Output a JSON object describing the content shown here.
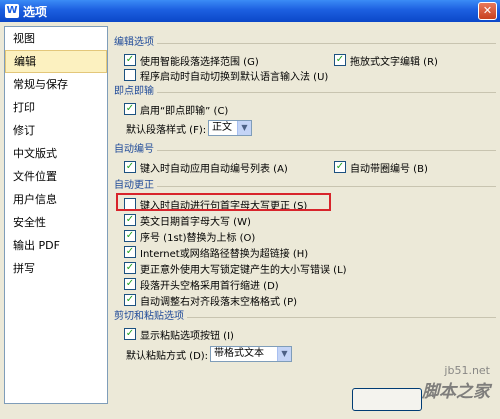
{
  "window": {
    "title": "选项",
    "app_icon": "wps-icon"
  },
  "sidebar": {
    "items": [
      {
        "label": "视图"
      },
      {
        "label": "编辑",
        "selected": true
      },
      {
        "label": "常规与保存"
      },
      {
        "label": "打印"
      },
      {
        "label": "修订"
      },
      {
        "label": "中文版式"
      },
      {
        "label": "文件位置"
      },
      {
        "label": "用户信息"
      },
      {
        "label": "安全性"
      },
      {
        "label": "输出 PDF"
      },
      {
        "label": "拼写"
      }
    ]
  },
  "editing_options": {
    "title": "编辑选项",
    "smart_select": {
      "label": "使用智能段落选择范围 (G)",
      "checked": true
    },
    "drag_drop": {
      "label": "拖放式文字编辑 (R)",
      "checked": true
    },
    "auto_ime": {
      "label": "程序启动时自动切换到默认语言输入法 (U)",
      "checked": false
    }
  },
  "click_type": {
    "title": "即点即输",
    "enable": {
      "label": "启用“即点即输” (C)",
      "checked": true
    },
    "default_style_label": "默认段落样式 (F):",
    "default_style_value": "正文"
  },
  "auto_numbering": {
    "title": "自动编号",
    "auto_list": {
      "label": "键入时自动应用自动编号列表 (A)",
      "checked": true
    },
    "auto_circled": {
      "label": "自动带圈编号 (B)",
      "checked": true
    }
  },
  "auto_correct": {
    "title": "自动更正",
    "capitalize_first": {
      "label": "键入时自动进行句首字母大写更正 (S)",
      "checked": false
    },
    "english_days": {
      "label": "英文日期首字母大写 (W)",
      "checked": true
    },
    "ordinals": {
      "label": "序号 (1st)替换为上标 (O)",
      "checked": true
    },
    "hyperlinks": {
      "label": "Internet或网络路径替换为超链接 (H)",
      "checked": true
    },
    "caps_lock": {
      "label": "更正意外使用大写锁定键产生的大小写错误 (L)",
      "checked": true
    },
    "leading_spaces": {
      "label": "段落开头空格采用首行缩进 (D)",
      "checked": true
    },
    "trailing_spaces": {
      "label": "自动调整右对齐段落末空格格式 (P)",
      "checked": true
    }
  },
  "paste_options": {
    "title": "剪切和粘贴选项",
    "show_button": {
      "label": "显示粘贴选项按钮 (I)",
      "checked": true
    },
    "default_paste_label": "默认粘贴方式 (D):",
    "default_paste_value": "带格式文本"
  },
  "check_mark": "✓",
  "watermark": {
    "url": "jb51.net",
    "brand": "脚本之家"
  },
  "colors": {
    "title_bar": "#1c5fe0",
    "highlight_box": "#d8242b",
    "section_title": "#1f4a99"
  }
}
